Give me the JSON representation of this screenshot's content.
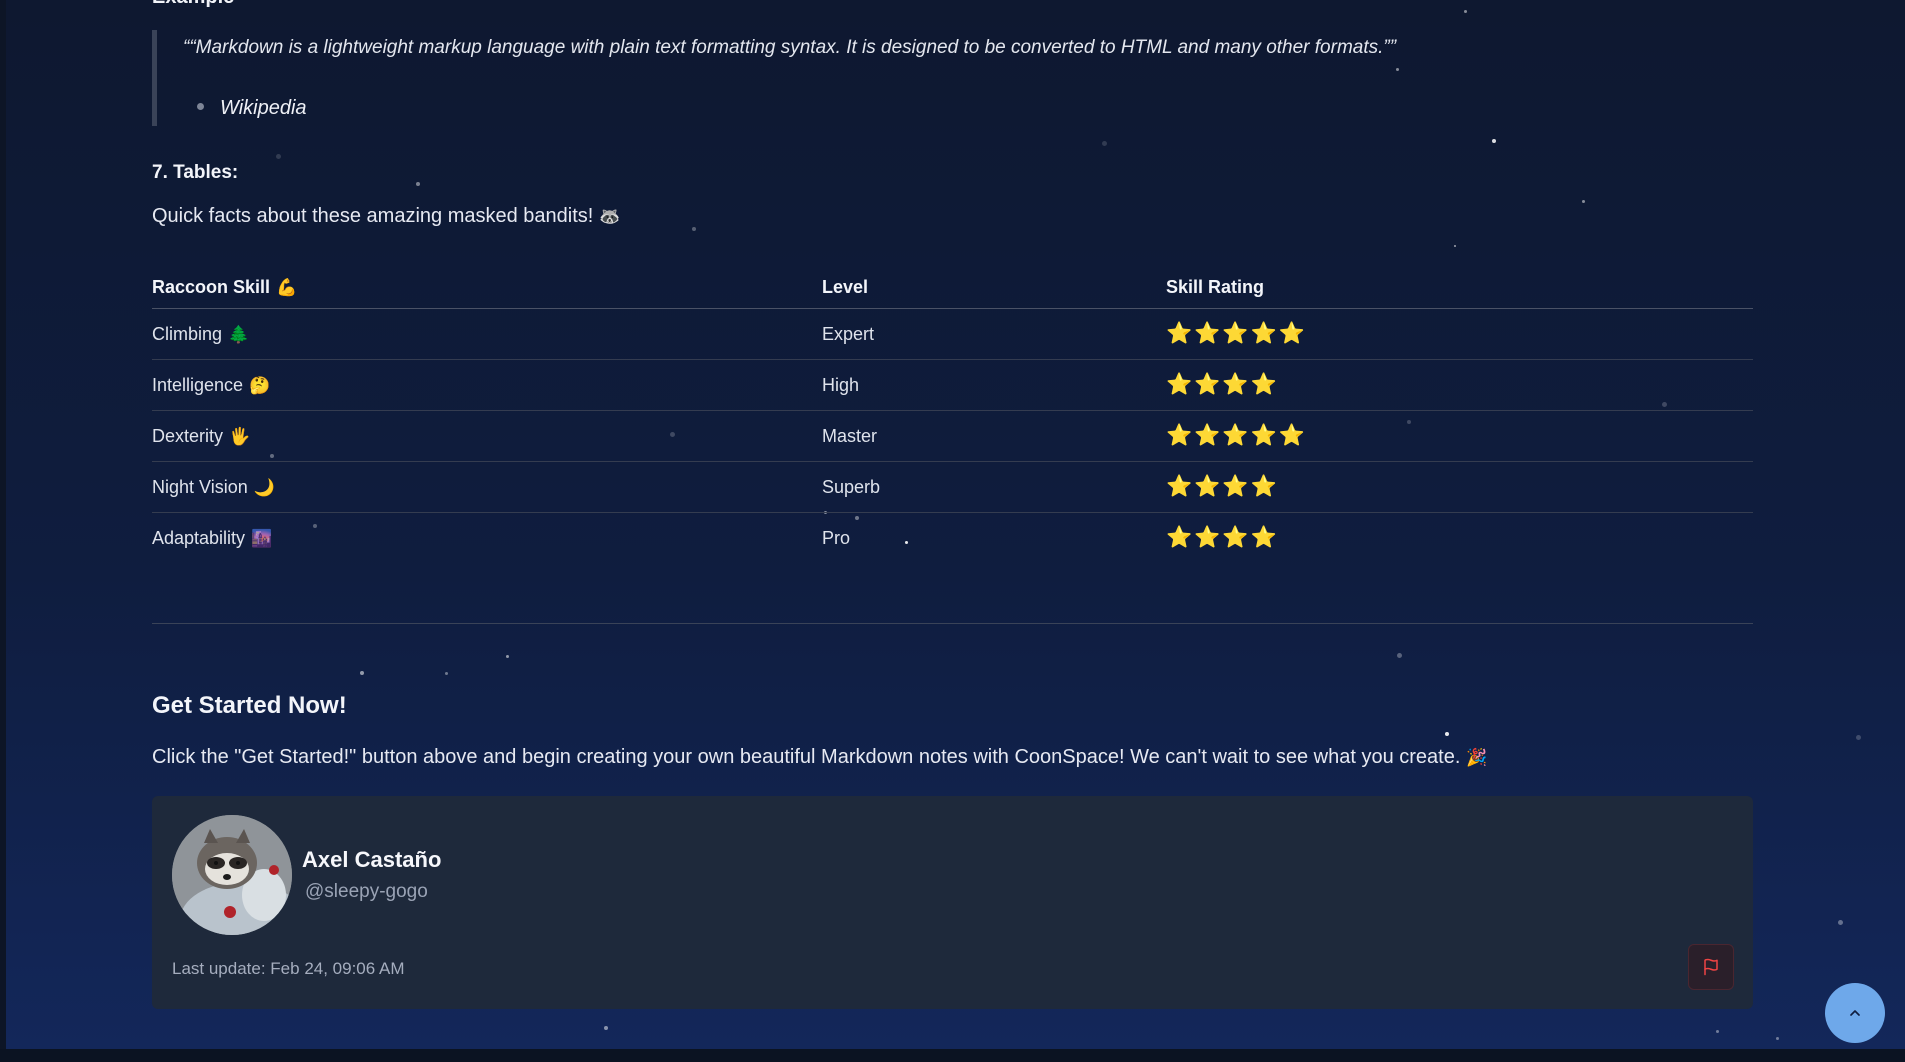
{
  "partial_heading": "Example",
  "blockquote": {
    "text": "““Markdown is a lightweight markup language with plain text formatting syntax. It is designed to be converted to HTML and many other formats.””",
    "attribution": "Wikipedia"
  },
  "tables_section": {
    "heading": "7. Tables:",
    "intro": "Quick facts about these amazing masked bandits!",
    "intro_emoji": "🦝"
  },
  "table": {
    "headers": [
      {
        "label": "Raccoon Skill",
        "emoji": "💪"
      },
      {
        "label": "Level",
        "emoji": ""
      },
      {
        "label": "Skill Rating",
        "emoji": ""
      }
    ],
    "rows": [
      {
        "skill": "Climbing",
        "emoji": "🌲",
        "level": "Expert",
        "rating": "⭐⭐⭐⭐⭐"
      },
      {
        "skill": "Intelligence",
        "emoji": "🤔",
        "level": "High",
        "rating": "⭐⭐⭐⭐"
      },
      {
        "skill": "Dexterity",
        "emoji": "🖐",
        "level": "Master",
        "rating": "⭐⭐⭐⭐⭐"
      },
      {
        "skill": "Night Vision",
        "emoji": "🌙",
        "level": "Superb",
        "rating": "⭐⭐⭐⭐"
      },
      {
        "skill": "Adaptability",
        "emoji": "🌆",
        "level": "Pro",
        "rating": "⭐⭐⭐⭐"
      }
    ]
  },
  "get_started": {
    "heading": "Get Started Now!",
    "text": "Click the \"Get Started!\" button above and begin creating your own beautiful Markdown notes with CoonSpace! We can't wait to see what you create.",
    "emoji": "🎉"
  },
  "author": {
    "name": "Axel Castaño",
    "handle": "@sleepy-gogo",
    "last_update": "Last update: Feb 24, 09:06 AM"
  },
  "icons": {
    "flag": "flag-icon",
    "scroll_top": "chevron-up-icon"
  },
  "colors": {
    "star_gold": "#f5b82e",
    "flag_red": "#ef4444",
    "scroll_button": "#6ea8ea",
    "card_bg": "#1e293b"
  }
}
